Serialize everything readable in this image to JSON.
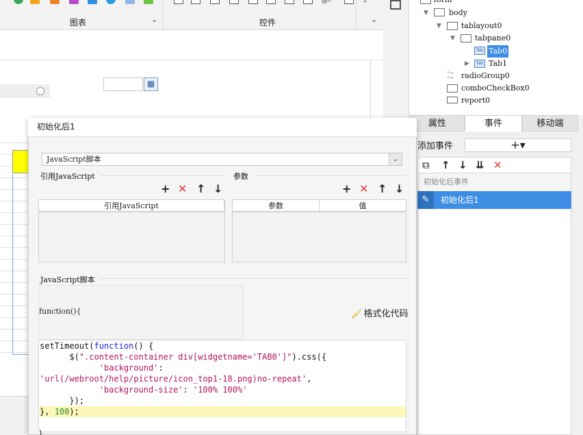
{
  "ribbon": {
    "group_chart": "图表",
    "group_controls": "控件"
  },
  "tree": {
    "nodes": [
      {
        "label": "form"
      },
      {
        "label": "body"
      },
      {
        "label": "tablayout0"
      },
      {
        "label": "tabpane0"
      },
      {
        "label": "Tab0",
        "selected": true
      },
      {
        "label": "Tab1"
      },
      {
        "label": "radioGroup0"
      },
      {
        "label": "comboCheckBox0"
      },
      {
        "label": "report0"
      }
    ],
    "tab_icon_text": "Tab"
  },
  "right_panel": {
    "tabs": [
      "属性",
      "事件",
      "移动端"
    ],
    "active_tab": "事件",
    "add_event_label": "添加事件",
    "add_event_button": "+▾",
    "event_group_label": "初始化后事件",
    "event_item_label": "初始化后1"
  },
  "dialog": {
    "title": "初始化后1",
    "type_select_value": "JavaScript脚本",
    "ref_js_section": "引用JavaScript",
    "params_section": "参数",
    "ref_js_column": "引用JavaScript",
    "params_columns": [
      "参数",
      "值"
    ],
    "js_section": "JavaScript脚本",
    "function_header": "function(){",
    "format_button": "格式化代码",
    "closing_brace": "}",
    "code_lines": [
      "setTimeout(function() {",
      "      $(\".content-container div[widgetname='TAB0']\").css({",
      "            'background':",
      "'url(/webroot/help/picture/icon_top1-18.png)no-repeat',",
      "            'background-size': '100% 100%'",
      "      });",
      "}, 100);"
    ]
  },
  "colors": {
    "selection_blue": "#3d8ee4",
    "delete_red": "#e53935",
    "highlight_yellow": "#fbf7b7",
    "cell_yellow": "#ffff00"
  }
}
